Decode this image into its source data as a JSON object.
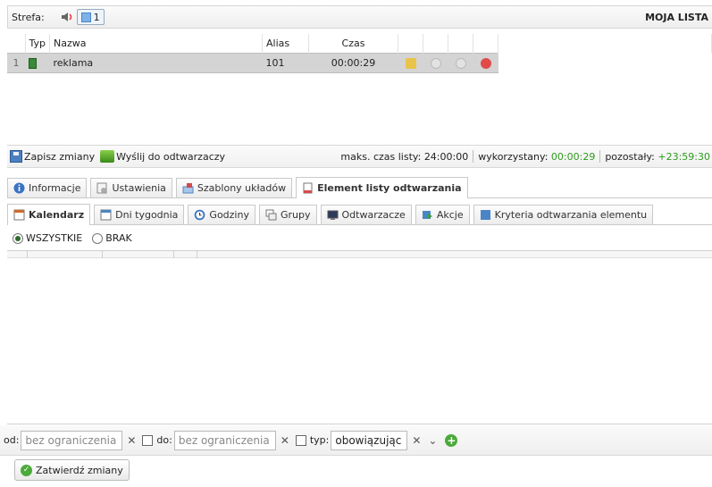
{
  "strefa": {
    "label": "Strefa:",
    "zone_number": "1",
    "list_title": "MOJA LISTA"
  },
  "table": {
    "headers": {
      "typ": "Typ",
      "nazwa": "Nazwa",
      "alias": "Alias",
      "czas": "Czas"
    },
    "rows": [
      {
        "num": "1",
        "nazwa": "reklama",
        "alias": "101",
        "czas": "00:00:29"
      }
    ]
  },
  "status": {
    "save": "Zapisz zmiany",
    "send": "Wyślij do odtwarzaczy",
    "max_label": "maks. czas listy:",
    "max_value": "24:00:00",
    "used_label": "wykorzystany:",
    "used_value": "00:00:29",
    "left_label": "pozostały:",
    "left_value": "+23:59:30"
  },
  "tabs_main": [
    "Informacje",
    "Ustawienia",
    "Szablony układów",
    "Element listy odtwarzania"
  ],
  "tabs_sub": [
    "Kalendarz",
    "Dni tygodnia",
    "Godziny",
    "Grupy",
    "Odtwarzacze",
    "Akcje",
    "Kryteria odtwarzania elementu"
  ],
  "radio": {
    "all": "WSZYSTKIE",
    "none": "BRAK"
  },
  "filter": {
    "from_label": "od:",
    "from_value": "bez ograniczenia",
    "to_label": "do:",
    "to_value": "bez ograniczenia",
    "type_label": "typ:",
    "type_value": "obowiązując"
  },
  "confirm": "Zatwierdź zmiany",
  "colors": {
    "green_text": "#2f9a1e",
    "selected_row": "#d4d4d4",
    "accent_blue": "#4c7fc0"
  }
}
